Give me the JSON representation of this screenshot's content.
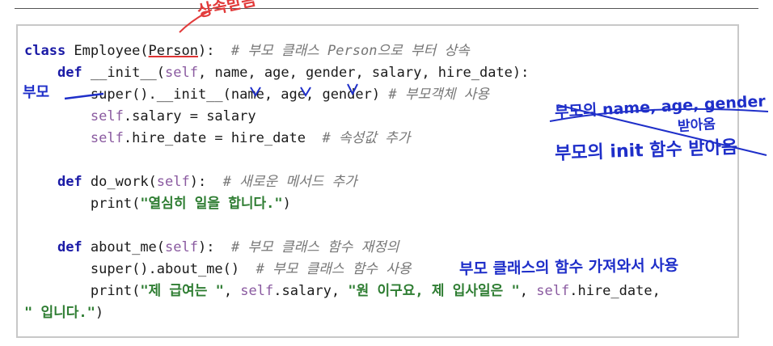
{
  "code": {
    "line1": {
      "kw": "class",
      "name": " Employee(",
      "base": "Person",
      "rest": "):  ",
      "comment": "# 부모 클래스 Person으로 부터 상속"
    },
    "line2": {
      "indent": "    ",
      "kw": "def",
      "sig_a": " __init__(",
      "self": "self",
      "sig_b": ", name, age, gender, salary, hire_date):"
    },
    "line3": {
      "indent": "        ",
      "call": "super().__init__(name, age, gender) ",
      "comment": "# 부모객체 사용"
    },
    "line4": {
      "indent": "        ",
      "self": "self",
      "rest": ".salary = salary"
    },
    "line5": {
      "indent": "        ",
      "self": "self",
      "rest": ".hire_date = hire_date  ",
      "comment": "# 속성값 추가"
    },
    "line6": {
      "text": ""
    },
    "line7": {
      "indent": "    ",
      "kw": "def",
      "sig_a": " do_work(",
      "self": "self",
      "sig_b": "):  ",
      "comment": "# 새로운 메서드 추가"
    },
    "line8": {
      "indent": "        ",
      "pre": "print(",
      "str": "\"열심히 일을 합니다.\"",
      "post": ")"
    },
    "line9": {
      "text": ""
    },
    "line10": {
      "indent": "    ",
      "kw": "def",
      "sig_a": " about_me(",
      "self": "self",
      "sig_b": "):  ",
      "comment": "# 부모 클래스 함수 재정의"
    },
    "line11": {
      "indent": "        ",
      "call": "super().about_me()  ",
      "comment": "# 부모 클래스 함수 사용"
    },
    "line12": {
      "indent": "        ",
      "pre": "print(",
      "s1": "\"제 급여는 \"",
      "m1": ", ",
      "self1": "self",
      "m2": ".salary, ",
      "s2": "\"원 이구요, 제 입사일은 \"",
      "m3": ", ",
      "self2": "self",
      "m4": ".hire_date,"
    },
    "line13": {
      "s1": "\" 입니다.\"",
      "post": ")"
    }
  },
  "annotations": {
    "inheritance": "상속받음",
    "parent": "부모",
    "parent_args": "부모의 name, age, gender",
    "received": "받아옴",
    "parent_init": "부모의 init 함수 받아옴",
    "parent_class_fn": "부모 클래스의 함수 가져와서 사용"
  },
  "colors": {
    "keyword": "#1a1aa6",
    "self": "#8a5aa0",
    "comment": "#777777",
    "string": "#2e7d32",
    "ink_blue": "#1f2fc9",
    "ink_red": "#e23b3b"
  }
}
